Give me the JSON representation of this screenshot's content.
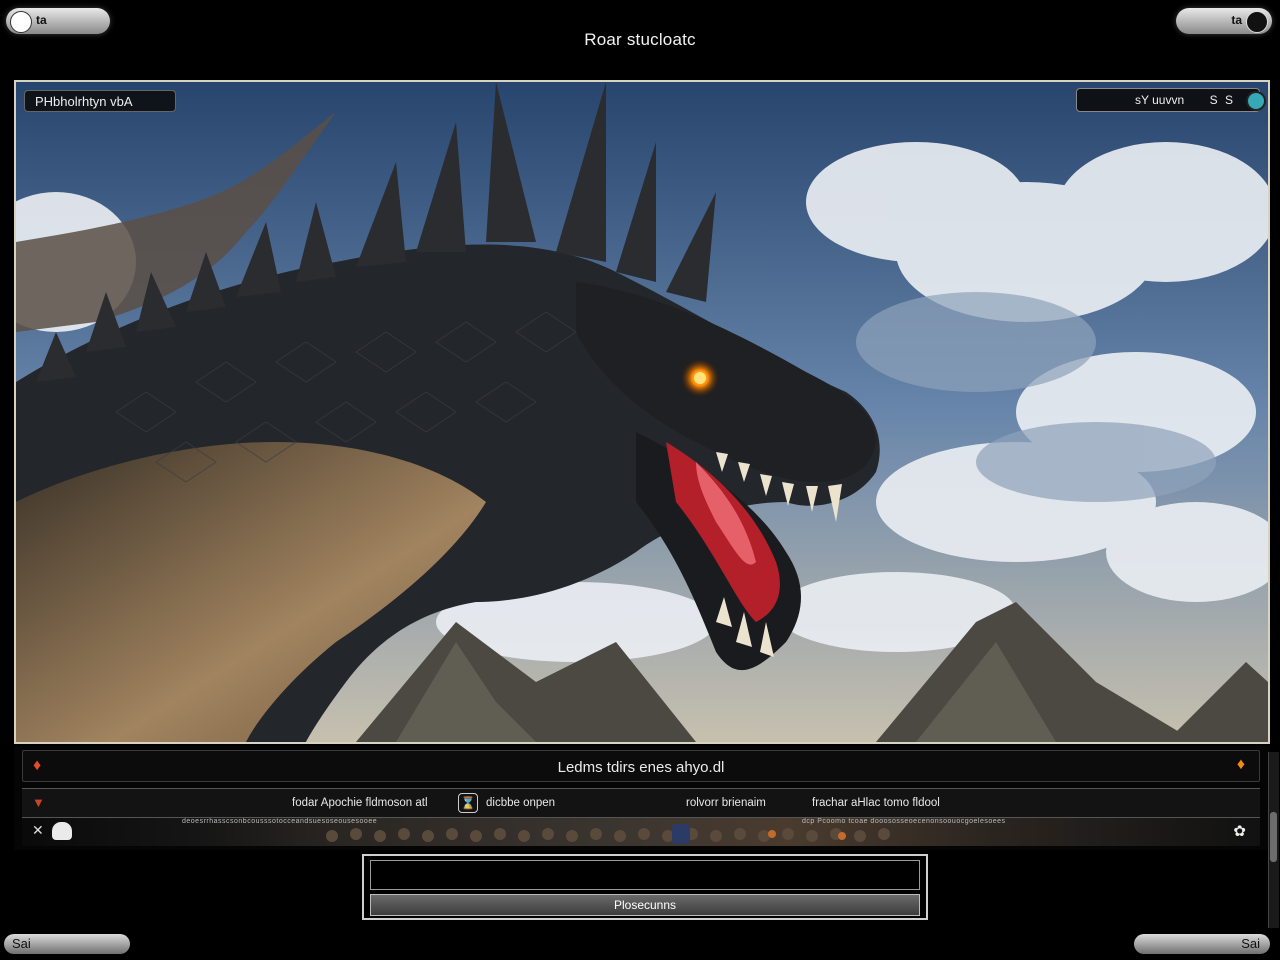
{
  "window": {
    "title": "Roar stucloatc"
  },
  "top_left": {
    "icon": "record-dot-icon",
    "glyph": "ta"
  },
  "top_right": {
    "icon": "toggle-knob-icon",
    "glyph": "ta"
  },
  "viewport": {
    "label": "PHbholrhtyn vbA",
    "status_text": "sY uuvvn",
    "status_dots": "S S",
    "scene": "dragon-scene"
  },
  "panel": {
    "row1": {
      "caption": "Ledms tdirs enes    ahyo.dl",
      "left_icon": "flame-icon",
      "right_icon": "flame-icon"
    },
    "row2": {
      "cells": [
        "fodar Apochie fldmoson atl",
        "dicbbe onpen",
        "rolvorr brienaim",
        "frachar aHlac tomo fldool"
      ],
      "left_icon": "flame-icon",
      "button_icon": "hourglass-icon"
    },
    "row3": {
      "fine_left": "deoesrrhasscsonbcousssotocceandsuesoseousesooee",
      "fine_right": "dcp Pcoomo tcoae dooososseoecenonsoouocgoelesoees",
      "left_icon": "flame-icon",
      "avatar": "person-icon",
      "right_icon": "swirl-icon"
    }
  },
  "dialog": {
    "input_value": "",
    "button_label": "Plosecunns"
  },
  "bottom_left": {
    "glyph": "Sai"
  },
  "bottom_right": {
    "glyph": "Sai"
  }
}
